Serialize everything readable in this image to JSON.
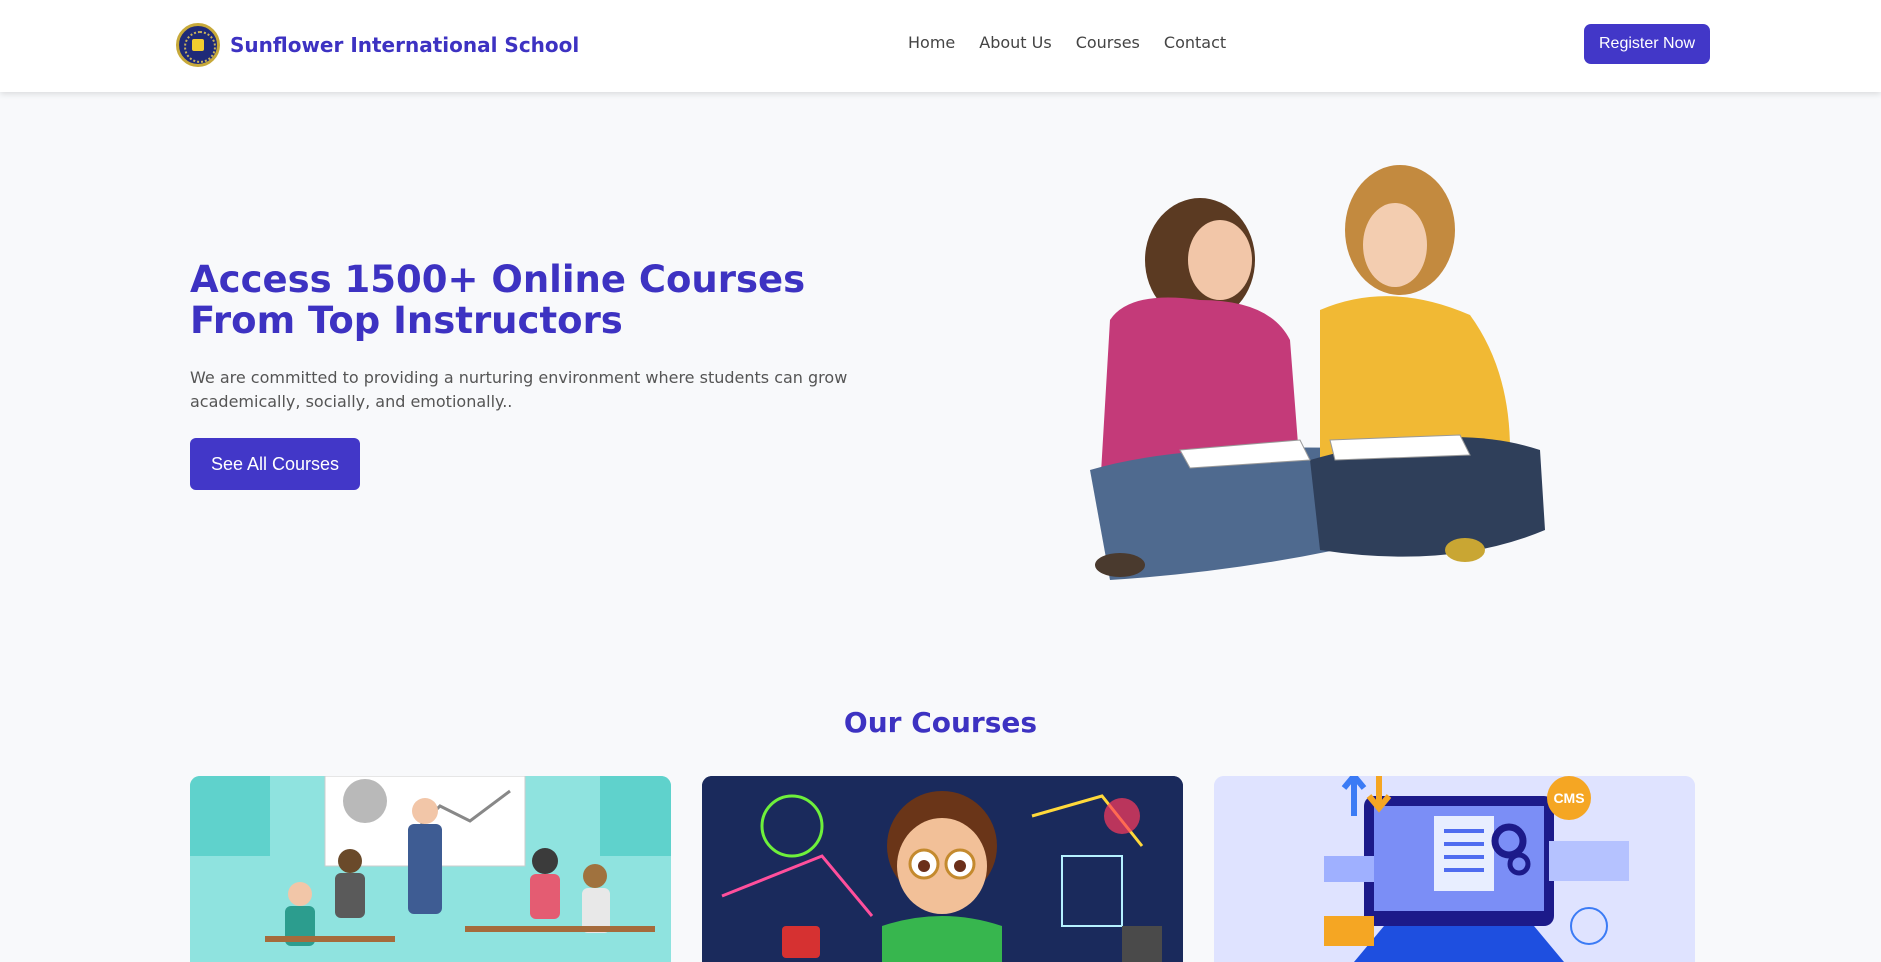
{
  "header": {
    "school_name": "Sunflower International School",
    "nav": [
      "Home",
      "About Us",
      "Courses",
      "Contact"
    ],
    "register_label": "Register Now"
  },
  "hero": {
    "title": "Access 1500+ Online Courses From Top Instructors",
    "description": "We are committed to providing a nurturing environment where students can grow academically, socially, and emotionally..",
    "cta_label": "See All Courses"
  },
  "courses": {
    "title": "Our Courses",
    "card_badge": "CMS"
  },
  "colors": {
    "primary": "#4237c8",
    "heading": "#3d32c2",
    "background": "#f8f9fb"
  }
}
